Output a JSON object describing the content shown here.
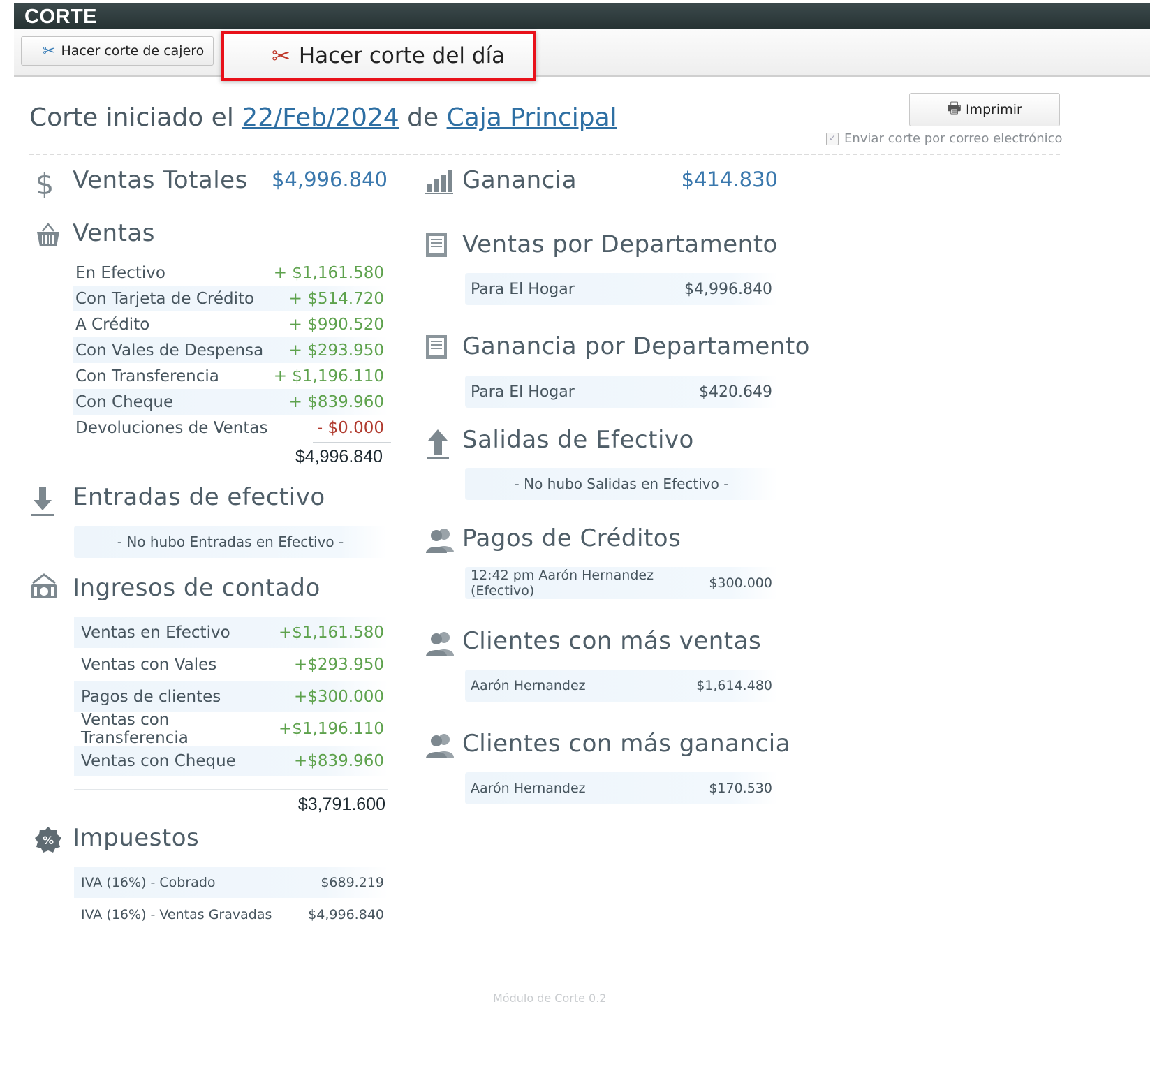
{
  "window": {
    "title": "CORTE"
  },
  "toolbar": {
    "cajero_label": "Hacer corte de cajero",
    "dia_label": "Hacer corte del día",
    "cut_icon": "scissors-icon"
  },
  "header": {
    "prefix": "Corte iniciado el ",
    "date": "22/Feb/2024",
    "middle": " de ",
    "caja": "Caja Principal",
    "print_label": "Imprimir",
    "email_label": "Enviar corte por correo electrónico",
    "email_checked": true
  },
  "ventas_totales": {
    "title": "Ventas Totales",
    "value": "$4,996.840"
  },
  "ganancia": {
    "title": "Ganancia",
    "value": "$414.830"
  },
  "ventas": {
    "title": "Ventas",
    "rows": [
      {
        "label": "En Efectivo",
        "value": "+ $1,161.580"
      },
      {
        "label": "Con Tarjeta de Crédito",
        "value": "+ $514.720"
      },
      {
        "label": "A Crédito",
        "value": "+ $990.520"
      },
      {
        "label": "Con Vales de Despensa",
        "value": "+ $293.950"
      },
      {
        "label": "Con Transferencia",
        "value": "+ $1,196.110"
      },
      {
        "label": "Con Cheque",
        "value": "+ $839.960"
      },
      {
        "label": "Devoluciones de Ventas",
        "value": "- $0.000"
      }
    ],
    "total": "$4,996.840"
  },
  "entradas": {
    "title": "Entradas de efectivo",
    "empty": "- No hubo Entradas en Efectivo -"
  },
  "ingresos": {
    "title": "Ingresos de contado",
    "rows": [
      {
        "label": "Ventas en Efectivo",
        "value": "+$1,161.580"
      },
      {
        "label": "Ventas con Vales",
        "value": "+$293.950"
      },
      {
        "label": "Pagos de clientes",
        "value": "+$300.000"
      },
      {
        "label": "Ventas con Transferencia",
        "value": "+$1,196.110"
      },
      {
        "label": "Ventas con Cheque",
        "value": "+$839.960"
      }
    ],
    "total": "$3,791.600"
  },
  "impuestos": {
    "title": "Impuestos",
    "rows": [
      {
        "label": "IVA (16%) - Cobrado",
        "value": "$689.219"
      },
      {
        "label": "IVA (16%) - Ventas Gravadas",
        "value": "$4,996.840"
      }
    ]
  },
  "ventas_depto": {
    "title": "Ventas por Departamento",
    "rows": [
      {
        "label": "Para El Hogar",
        "value": "$4,996.840"
      }
    ]
  },
  "ganancia_depto": {
    "title": "Ganancia por Departamento",
    "rows": [
      {
        "label": "Para El Hogar",
        "value": "$420.649"
      }
    ]
  },
  "salidas": {
    "title": "Salidas de Efectivo",
    "empty": "- No hubo Salidas en Efectivo -"
  },
  "pagos_creditos": {
    "title": "Pagos de Créditos",
    "rows": [
      {
        "label": "12:42 pm Aarón Hernandez (Efectivo)",
        "value": "$300.000"
      }
    ]
  },
  "clientes_ventas": {
    "title": "Clientes con más ventas",
    "rows": [
      {
        "label": "Aarón Hernandez",
        "value": "$1,614.480"
      }
    ]
  },
  "clientes_ganancia": {
    "title": "Clientes con más ganancia",
    "rows": [
      {
        "label": "Aarón Hernandez",
        "value": "$170.530"
      }
    ]
  },
  "footer": {
    "version": "Módulo de Corte 0.2"
  },
  "colors": {
    "accent": "#2e6fa3",
    "positive": "#5ea24d",
    "negative": "#b03a2e",
    "highlight": "#e8111a"
  }
}
